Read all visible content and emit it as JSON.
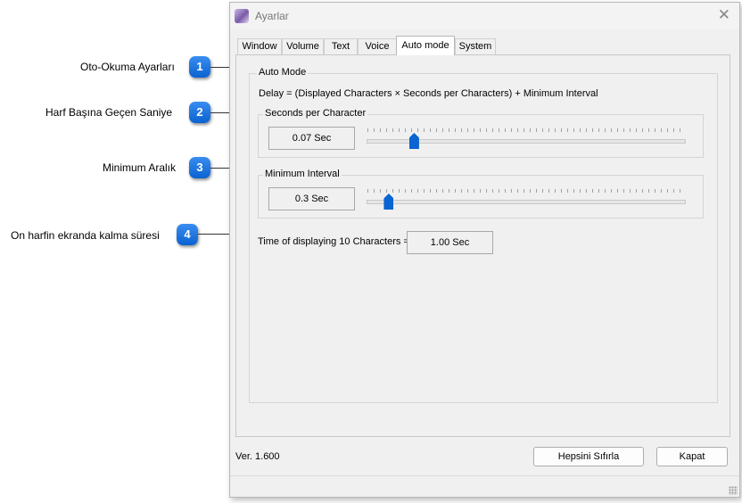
{
  "callouts": [
    {
      "number": "1",
      "label": "Oto-Okuma Ayarları"
    },
    {
      "number": "2",
      "label": "Harf Başına Geçen Saniye"
    },
    {
      "number": "3",
      "label": "Minimum Aralık"
    },
    {
      "number": "4",
      "label": "On harfin ekranda kalma süresi"
    }
  ],
  "window": {
    "title": "Ayarlar",
    "close_glyph": "✕"
  },
  "tabs": [
    {
      "label": "Window"
    },
    {
      "label": "Volume"
    },
    {
      "label": "Text"
    },
    {
      "label": "Voice"
    },
    {
      "label": "Auto mode",
      "active": true
    },
    {
      "label": "System"
    }
  ],
  "auto_mode": {
    "group_title": "Auto Mode",
    "formula": "Delay = (Displayed Characters × Seconds per Characters) + Minimum Interval",
    "seconds_per_character": {
      "label": "Seconds per Character",
      "value_text": "0.07 Sec",
      "slider_fraction": 0.15
    },
    "minimum_interval": {
      "label": "Minimum Interval",
      "value_text": "0.3 Sec",
      "slider_fraction": 0.07
    },
    "ten_chars": {
      "label": "Time of displaying 10 Characters =",
      "value_text": "1.00 Sec"
    }
  },
  "footer": {
    "version": "Ver. 1.600",
    "reset_label": "Hepsini Sıfırla",
    "close_label": "Kapat"
  },
  "colors": {
    "badge": "#1570e0",
    "slider_thumb": "#0a64d2"
  }
}
